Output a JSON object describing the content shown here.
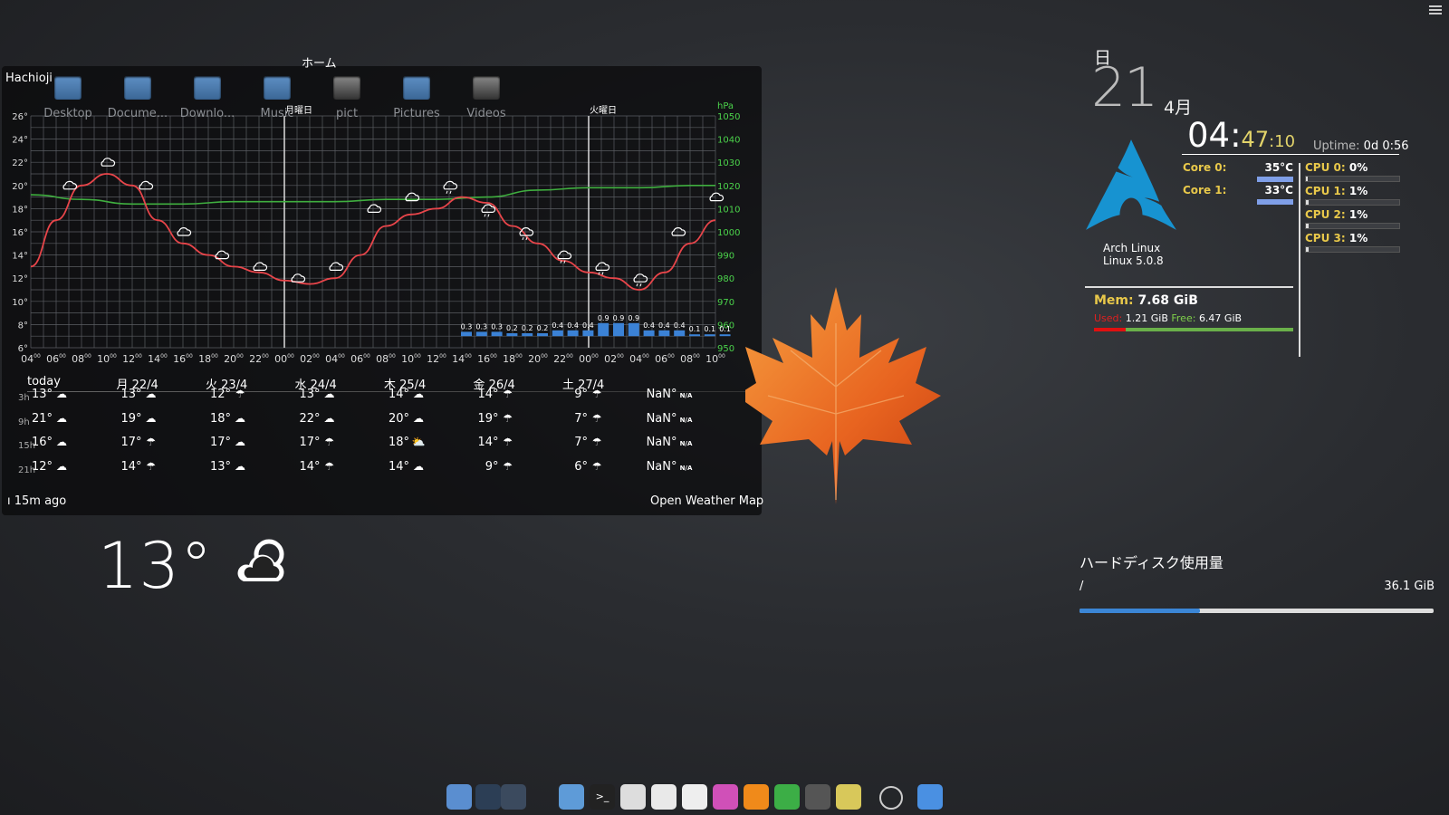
{
  "folder_view": {
    "title": "ホーム",
    "items": [
      {
        "label": "Desktop",
        "icon": "folder-icon"
      },
      {
        "label": "Docume...",
        "icon": "folder-icon"
      },
      {
        "label": "Downlo...",
        "icon": "folder-icon"
      },
      {
        "label": "Music",
        "icon": "folder-icon"
      },
      {
        "label": "pict",
        "icon": "image-icon"
      },
      {
        "label": "Pictures",
        "icon": "folder-icon"
      },
      {
        "label": "Videos",
        "icon": "video-folder-icon"
      }
    ]
  },
  "weather": {
    "city": "Hachioji",
    "pressure_unit": "hPa",
    "day_markers": [
      "月曜日",
      "火曜日"
    ],
    "updated": "15m ago",
    "provider": "Open Weather Map",
    "current_temp": "13°",
    "current_icon": "partly-cloudy-icon",
    "forecast_days": [
      "today",
      "月 22/4",
      "火 23/4",
      "水 24/4",
      "木 25/4",
      "金 26/4",
      "土 27/4"
    ],
    "forecast_rows": [
      {
        "hour": "3h",
        "cells": [
          [
            "13°",
            "cloud"
          ],
          [
            "13°",
            "cloud"
          ],
          [
            "12°",
            "rain"
          ],
          [
            "13°",
            "cloud"
          ],
          [
            "14°",
            "cloud"
          ],
          [
            "14°",
            "rain"
          ],
          [
            "9°",
            "rain"
          ],
          [
            "NaN°",
            "N/A"
          ]
        ]
      },
      {
        "hour": "9h",
        "cells": [
          [
            "21°",
            "cloud"
          ],
          [
            "19°",
            "cloud"
          ],
          [
            "18°",
            "cloud"
          ],
          [
            "22°",
            "cloud"
          ],
          [
            "20°",
            "cloud"
          ],
          [
            "19°",
            "rain"
          ],
          [
            "7°",
            "rain"
          ],
          [
            "NaN°",
            "N/A"
          ]
        ]
      },
      {
        "hour": "15h",
        "cells": [
          [
            "16°",
            "cloud"
          ],
          [
            "17°",
            "rain"
          ],
          [
            "17°",
            "cloud"
          ],
          [
            "17°",
            "rain"
          ],
          [
            "18°",
            "sun-cloud"
          ],
          [
            "14°",
            "rain"
          ],
          [
            "7°",
            "rain"
          ],
          [
            "NaN°",
            "N/A"
          ]
        ]
      },
      {
        "hour": "21h",
        "cells": [
          [
            "12°",
            "cloud"
          ],
          [
            "14°",
            "rain"
          ],
          [
            "13°",
            "cloud"
          ],
          [
            "14°",
            "rain"
          ],
          [
            "14°",
            "cloud"
          ],
          [
            "9°",
            "rain"
          ],
          [
            "6°",
            "rain"
          ],
          [
            "NaN°",
            "N/A"
          ]
        ]
      }
    ]
  },
  "chart_data": {
    "type": "line",
    "x": [
      "04",
      "06",
      "08",
      "10",
      "12",
      "14",
      "16",
      "18",
      "20",
      "22",
      "00",
      "02",
      "04",
      "06",
      "08",
      "10",
      "12",
      "14",
      "16",
      "18",
      "20",
      "22",
      "00",
      "02",
      "04",
      "06",
      "08",
      "10"
    ],
    "x_label_tick": "00",
    "y_left_ticks": [
      "26°",
      "24°",
      "22°",
      "20°",
      "18°",
      "16°",
      "14°",
      "12°",
      "10°",
      "8°",
      "6°"
    ],
    "y_right_ticks": [
      "1050",
      "1040",
      "1030",
      "1020",
      "1010",
      "1000",
      "990",
      "980",
      "970",
      "960",
      "950"
    ],
    "ylim_temp": [
      6,
      26
    ],
    "ylim_pressure": [
      950,
      1050
    ],
    "grid": true,
    "series": [
      {
        "unit": "°C",
        "color": "#e8454a",
        "points": [
          [
            0,
            13
          ],
          [
            1,
            17
          ],
          [
            2,
            20
          ],
          [
            3,
            21
          ],
          [
            4,
            20
          ],
          [
            5,
            17
          ],
          [
            6,
            15
          ],
          [
            7,
            14
          ],
          [
            8,
            13
          ],
          [
            9,
            12.5
          ],
          [
            10,
            11.8
          ],
          [
            11,
            11.5
          ],
          [
            12,
            12
          ],
          [
            13,
            14
          ],
          [
            14,
            16.5
          ],
          [
            15,
            17.5
          ],
          [
            16,
            18
          ],
          [
            17,
            19
          ],
          [
            18,
            18.5
          ],
          [
            19,
            16.5
          ],
          [
            20,
            15
          ],
          [
            21,
            13.5
          ],
          [
            22,
            12.5
          ],
          [
            23,
            12
          ],
          [
            24,
            11
          ],
          [
            25,
            12.5
          ],
          [
            26,
            15
          ],
          [
            27,
            17
          ]
        ]
      },
      {
        "unit": "hPa",
        "color": "#3fae3f",
        "points": [
          [
            0,
            1016
          ],
          [
            2,
            1014
          ],
          [
            4,
            1012
          ],
          [
            6,
            1012
          ],
          [
            8,
            1013
          ],
          [
            10,
            1013
          ],
          [
            12,
            1013
          ],
          [
            14,
            1014
          ],
          [
            16,
            1014
          ],
          [
            18,
            1015
          ],
          [
            20,
            1018
          ],
          [
            22,
            1019
          ],
          [
            24,
            1019
          ],
          [
            26,
            1020
          ],
          [
            27,
            1020
          ]
        ]
      }
    ],
    "precipitation_mm": [
      {
        "x": 17,
        "v": "0.3"
      },
      {
        "x": 17.6,
        "v": "0.3"
      },
      {
        "x": 18.2,
        "v": "0.3"
      },
      {
        "x": 18.8,
        "v": "0.2"
      },
      {
        "x": 19.4,
        "v": "0.2"
      },
      {
        "x": 20,
        "v": "0.2"
      },
      {
        "x": 20.6,
        "v": "0.4"
      },
      {
        "x": 21.2,
        "v": "0.4"
      },
      {
        "x": 21.8,
        "v": "0.4"
      },
      {
        "x": 22.4,
        "v": "0.9"
      },
      {
        "x": 23,
        "v": "0.9"
      },
      {
        "x": 23.6,
        "v": "0.9"
      },
      {
        "x": 24.2,
        "v": "0.4"
      },
      {
        "x": 24.8,
        "v": "0.4"
      },
      {
        "x": 25.4,
        "v": "0.4"
      },
      {
        "x": 26,
        "v": "0.1"
      },
      {
        "x": 26.6,
        "v": "0.1"
      },
      {
        "x": 27.2,
        "v": "0.1"
      }
    ],
    "weather_icons": [
      {
        "x": 1,
        "t": 20,
        "i": "cloud"
      },
      {
        "x": 2,
        "t": 22,
        "i": "cloud"
      },
      {
        "x": 3,
        "t": 20,
        "i": "cloud"
      },
      {
        "x": 4,
        "t": 16,
        "i": "cloud"
      },
      {
        "x": 5,
        "t": 14,
        "i": "cloud"
      },
      {
        "x": 6,
        "t": 13,
        "i": "cloud"
      },
      {
        "x": 7,
        "t": 12,
        "i": "cloud"
      },
      {
        "x": 8,
        "t": 13,
        "i": "cloud"
      },
      {
        "x": 9,
        "t": 18,
        "i": "cloud"
      },
      {
        "x": 10,
        "t": 19,
        "i": "cloud"
      },
      {
        "x": 11,
        "t": 20,
        "i": "rain"
      },
      {
        "x": 12,
        "t": 18,
        "i": "rain"
      },
      {
        "x": 13,
        "t": 16,
        "i": "rain"
      },
      {
        "x": 14,
        "t": 14,
        "i": "rain"
      },
      {
        "x": 15,
        "t": 13,
        "i": "rain"
      },
      {
        "x": 16,
        "t": 12,
        "i": "rain"
      },
      {
        "x": 17,
        "t": 16,
        "i": "cloud"
      },
      {
        "x": 18,
        "t": 19,
        "i": "cloud"
      }
    ]
  },
  "clock": {
    "day_of_week": "日",
    "day": "21",
    "month": "4月",
    "hour_colon": "04:",
    "minutes": "47",
    "seconds": ":10",
    "uptime_label": "Uptime:",
    "uptime_value": "0d 0:56"
  },
  "system": {
    "distro": "Arch Linux",
    "kernel": "Linux 5.0.8",
    "cores": [
      {
        "label": "Core 0:",
        "temp": "35°C"
      },
      {
        "label": "Core 1:",
        "temp": "33°C"
      }
    ],
    "cpus": [
      {
        "label": "CPU 0:",
        "value": "0%",
        "load": 0.02
      },
      {
        "label": "CPU 1:",
        "value": "1%",
        "load": 0.03
      },
      {
        "label": "CPU 2:",
        "value": "1%",
        "load": 0.03
      },
      {
        "label": "CPU 3:",
        "value": "1%",
        "load": 0.03
      }
    ],
    "mem_label": "Mem:",
    "mem_total": "7.68 GiB",
    "used_label": "Used:",
    "used_value": "1.21 GiB",
    "free_label": "Free:",
    "free_value": "6.47 GiB",
    "mem_used_fraction": 0.157
  },
  "disk": {
    "title": "ハードディスク使用量",
    "mount": "/",
    "size": "36.1 GiB",
    "used_fraction": 0.34
  },
  "dock": {
    "apps": [
      {
        "name": "files-icon",
        "color": "#5a8ed0"
      },
      {
        "name": "workspace-icon",
        "color": "#2c3e55"
      },
      {
        "name": "desktop-icon",
        "color": "#3b4a5e"
      },
      {
        "name": "folder-icon",
        "color": "#5e9bd8"
      },
      {
        "name": "terminal-icon",
        "color": "#222"
      },
      {
        "name": "editor-icon",
        "color": "#ddd"
      },
      {
        "name": "chrome-icon",
        "color": "#e9e9e9"
      },
      {
        "name": "mail-icon",
        "color": "#eee"
      },
      {
        "name": "gimp-icon",
        "color": "#d050b8"
      },
      {
        "name": "vlc-icon",
        "color": "#f08a1a"
      },
      {
        "name": "spreadsheet-icon",
        "color": "#3cae46"
      },
      {
        "name": "settings-icon",
        "color": "#555"
      },
      {
        "name": "pacman-icon",
        "color": "#d8c85a"
      },
      {
        "name": "power-icon",
        "color": "transparent"
      },
      {
        "name": "trash-icon",
        "color": "#4a90e2"
      }
    ]
  }
}
